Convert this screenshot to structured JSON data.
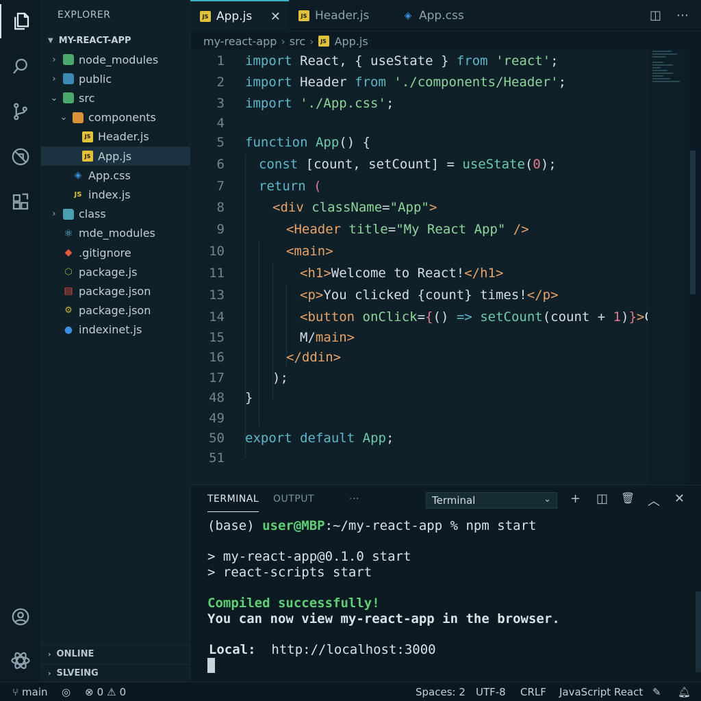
{
  "explorer": {
    "title": "EXPLORER",
    "project": "MY-REACT-APP",
    "tree": [
      {
        "label": "node_modules",
        "kind": "folder-green",
        "chev": "›",
        "indent": 0
      },
      {
        "label": "public",
        "kind": "folder-blue",
        "chev": "›",
        "indent": 0
      },
      {
        "label": "src",
        "kind": "folder-green",
        "chev": "⌄",
        "indent": 0
      },
      {
        "label": "components",
        "kind": "folder-orange",
        "chev": "⌄",
        "indent": 1
      },
      {
        "label": "Header.js",
        "kind": "js",
        "chev": "",
        "indent": 2
      },
      {
        "label": "App.js",
        "kind": "js",
        "chev": "",
        "indent": 2,
        "selected": true
      },
      {
        "label": "App.css",
        "kind": "css",
        "chev": "",
        "indent": 1
      },
      {
        "label": "index.js",
        "kind": "js-text",
        "chev": "",
        "indent": 1
      },
      {
        "label": "class",
        "kind": "folder-teal",
        "chev": "›",
        "indent": 0
      },
      {
        "label": "mde_modules",
        "kind": "react",
        "chev": "",
        "indent": 0
      },
      {
        "label": ".gitignore",
        "kind": "git",
        "chev": "",
        "indent": 0
      },
      {
        "label": "package.js",
        "kind": "node",
        "chev": "",
        "indent": 0
      },
      {
        "label": "package.json",
        "kind": "npm",
        "chev": "",
        "indent": 0
      },
      {
        "label": "package.json",
        "kind": "json",
        "chev": "",
        "indent": 0
      },
      {
        "label": "indexinet.js",
        "kind": "info",
        "chev": "",
        "indent": 0
      }
    ],
    "sections": [
      "ONLINE",
      "SLVEING"
    ]
  },
  "tabs": [
    {
      "label": "App.js",
      "icon": "js",
      "active": true,
      "close": "✕"
    },
    {
      "label": "Header.js",
      "icon": "js",
      "active": false
    },
    {
      "label": "App.css",
      "icon": "css",
      "active": false
    }
  ],
  "breadcrumb": [
    "my-react-app",
    "src",
    "App.js"
  ],
  "editor": {
    "lines": [
      {
        "n": "1",
        "indent": 0,
        "tokens": [
          [
            "kw",
            "import"
          ],
          [
            "pun",
            " React, { useState } "
          ],
          [
            "kw",
            "from"
          ],
          [
            "pun",
            " "
          ],
          [
            "str",
            "'react'"
          ],
          [
            "pun",
            ";"
          ]
        ]
      },
      {
        "n": "2",
        "indent": 0,
        "tokens": [
          [
            "kw",
            "import"
          ],
          [
            "pun",
            " Header "
          ],
          [
            "kw",
            "from"
          ],
          [
            "pun",
            " "
          ],
          [
            "str",
            "'./components/Header'"
          ],
          [
            "pun",
            ";"
          ]
        ]
      },
      {
        "n": "3",
        "indent": 0,
        "tokens": [
          [
            "kw",
            "import"
          ],
          [
            "pun",
            " "
          ],
          [
            "str",
            "'./App.css'"
          ],
          [
            "pun",
            ";"
          ]
        ]
      },
      {
        "n": "4",
        "indent": 0,
        "tokens": []
      },
      {
        "n": "5",
        "indent": 0,
        "tokens": [
          [
            "kw",
            "function"
          ],
          [
            "pun",
            " "
          ],
          [
            "fn",
            "App"
          ],
          [
            "pun",
            "() {"
          ]
        ]
      },
      {
        "n": "6",
        "indent": 1,
        "tokens": [
          [
            "kw",
            "const"
          ],
          [
            "pun",
            " [count, setCount] = "
          ],
          [
            "fn",
            "useState"
          ],
          [
            "pun",
            "("
          ],
          [
            "num",
            "0"
          ],
          [
            "pun",
            ");"
          ]
        ]
      },
      {
        "n": "7",
        "indent": 1,
        "tokens": [
          [
            "kw",
            "return"
          ],
          [
            "pun",
            " "
          ],
          [
            "num",
            "("
          ]
        ]
      },
      {
        "n": "8",
        "indent": 2,
        "tokens": [
          [
            "tag",
            "<div"
          ],
          [
            "pun",
            " "
          ],
          [
            "attr",
            "className"
          ],
          [
            "pun",
            "="
          ],
          [
            "str",
            "\"App\""
          ],
          [
            "tag",
            ">"
          ]
        ]
      },
      {
        "n": "9",
        "indent": 3,
        "tokens": [
          [
            "tag",
            "<Header"
          ],
          [
            "pun",
            " "
          ],
          [
            "attr",
            "title"
          ],
          [
            "pun",
            "="
          ],
          [
            "str",
            "\"My React App\""
          ],
          [
            "pun",
            " "
          ],
          [
            "tag",
            "/>"
          ]
        ]
      },
      {
        "n": "10",
        "indent": 3,
        "tokens": [
          [
            "tag",
            "<main>"
          ]
        ]
      },
      {
        "n": "11",
        "indent": 4,
        "tokens": [
          [
            "tag",
            "<h1>"
          ],
          [
            "pun",
            "Welcome to React!"
          ],
          [
            "tag",
            "</h1>"
          ]
        ]
      },
      {
        "n": "13",
        "indent": 4,
        "tokens": [
          [
            "tag",
            "<p>"
          ],
          [
            "pun",
            "You clicked {count} times!"
          ],
          [
            "tag",
            "</p>"
          ]
        ]
      },
      {
        "n": "14",
        "indent": 4,
        "tokens": [
          [
            "tag",
            "<button"
          ],
          [
            "pun",
            " "
          ],
          [
            "attr",
            "onClick"
          ],
          [
            "pun",
            "="
          ],
          [
            "num",
            "{"
          ],
          [
            "pun",
            "() "
          ],
          [
            "kw",
            "=>"
          ],
          [
            "pun",
            " "
          ],
          [
            "fn",
            "setCount"
          ],
          [
            "pun",
            "(count + "
          ],
          [
            "num",
            "1"
          ],
          [
            "pun",
            ")"
          ],
          [
            "num",
            "}"
          ],
          [
            "tag",
            ">"
          ],
          [
            "pun",
            "Click"
          ]
        ]
      },
      {
        "n": "15",
        "indent": 4,
        "tokens": [
          [
            "pun",
            "M/"
          ],
          [
            "tag",
            "main>"
          ]
        ]
      },
      {
        "n": "16",
        "indent": 3,
        "tokens": [
          [
            "tag",
            "</ddin>"
          ]
        ]
      },
      {
        "n": "17",
        "indent": 2,
        "tokens": [
          [
            "pun",
            ");"
          ]
        ]
      },
      {
        "n": "48",
        "indent": 0,
        "tokens": [
          [
            "pun",
            "}"
          ]
        ]
      },
      {
        "n": "49",
        "indent": 0,
        "tokens": []
      },
      {
        "n": "50",
        "indent": 0,
        "tokens": [
          [
            "kw",
            "export"
          ],
          [
            "pun",
            " "
          ],
          [
            "kw",
            "default"
          ],
          [
            "pun",
            " "
          ],
          [
            "fn",
            "App"
          ],
          [
            "pun",
            ";"
          ]
        ]
      },
      {
        "n": "51",
        "indent": 0,
        "tokens": []
      }
    ]
  },
  "panel": {
    "tabs": [
      "TERMINAL",
      "OUTPUT",
      "···"
    ],
    "select": "Terminal",
    "tools": [
      "+",
      "◫",
      "🗑",
      "︿",
      "✕"
    ],
    "prompt_base": "(base) ",
    "prompt_user": "user@MBP",
    "prompt_rest": ":~/my-react-app % npm start",
    "out1": "> my-react-app@0.1.0 start",
    "out2": "> react-scripts start",
    "compiled": "Compiled successfully!",
    "view": "You can now view my-react-app in the browser.",
    "local_label": "  Local:",
    "local_url": "  http://localhost:3000"
  },
  "status": {
    "branch": "main",
    "errors": "0",
    "warnings": "0",
    "spaces": "Spaces: 2",
    "encoding": "UTF-8",
    "eol": "CRLF",
    "language": "JavaScript React"
  }
}
